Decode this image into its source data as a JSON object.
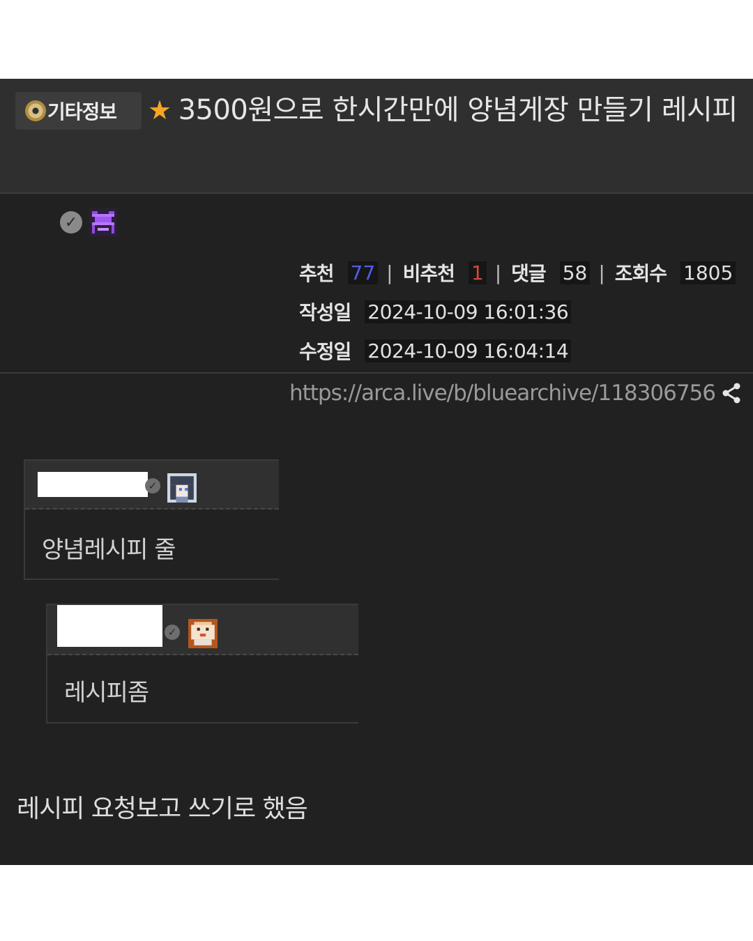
{
  "post": {
    "category": "기타정보",
    "title": "3500원으로 한시간만에 양념게장 만들기 레시피",
    "stats": {
      "recommend_label": "추천",
      "recommend_value": "77",
      "dislike_label": "비추천",
      "dislike_value": "1",
      "comments_label": "댓글",
      "comments_value": "58",
      "views_label": "조회수",
      "views_value": "1805",
      "separator": "|"
    },
    "created_label": "작성일",
    "created_value": "2024-10-09 16:01:36",
    "modified_label": "수정일",
    "modified_value": "2024-10-09 16:04:14",
    "url": "https://arca.live/b/bluearchive/118306756",
    "body": "레시피 요청보고 쓰기로 했음"
  },
  "comments": [
    {
      "text": "양념레시피 줄"
    },
    {
      "text": "레시피좀"
    }
  ],
  "colors": {
    "background": "#212121",
    "title_bar": "#2f2f2f",
    "recommend": "#4f5fe8",
    "dislike": "#d14a3a",
    "star": "#f5a623"
  },
  "icons": [
    "disc-icon",
    "star-icon",
    "verified-check-icon",
    "pixel-avatar",
    "share-icon"
  ]
}
